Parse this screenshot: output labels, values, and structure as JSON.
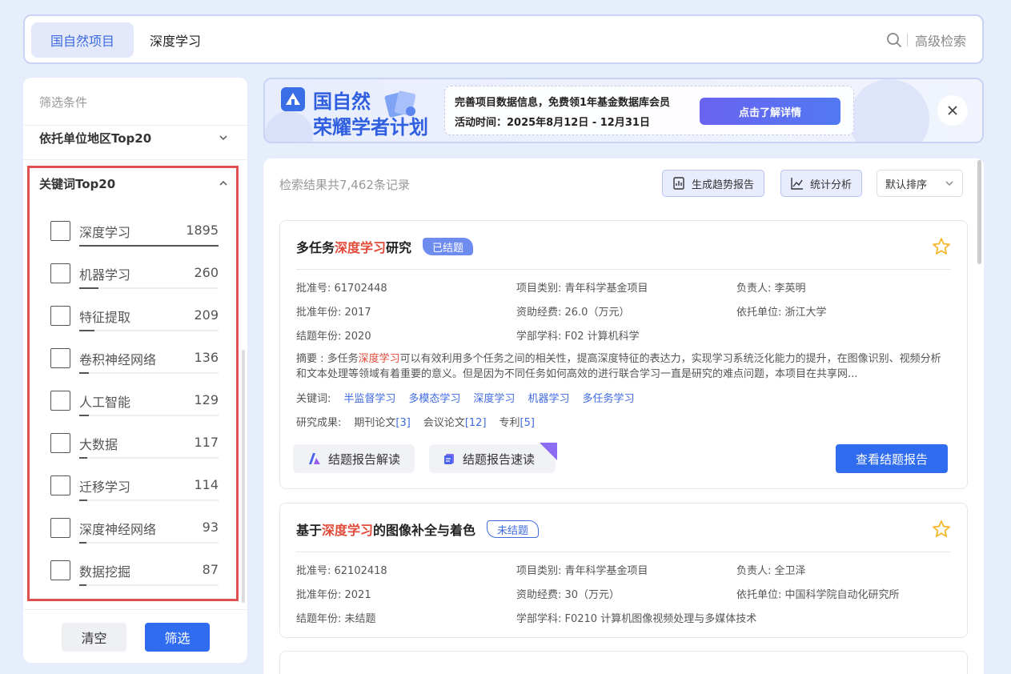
{
  "search": {
    "tab_label": "国自然项目",
    "query": "深度学习",
    "advanced_label": "高级检索"
  },
  "sidebar": {
    "title": "筛选条件",
    "section_region": "依托单位地区Top20",
    "section_keywords": "关键词Top20",
    "keywords": [
      {
        "label": "深度学习",
        "count": "1895",
        "share": 1.0
      },
      {
        "label": "机器学习",
        "count": "260",
        "share": 0.14
      },
      {
        "label": "特征提取",
        "count": "209",
        "share": 0.11
      },
      {
        "label": "卷积神经网络",
        "count": "136",
        "share": 0.07
      },
      {
        "label": "人工智能",
        "count": "129",
        "share": 0.07
      },
      {
        "label": "大数据",
        "count": "117",
        "share": 0.06
      },
      {
        "label": "迁移学习",
        "count": "114",
        "share": 0.06
      },
      {
        "label": "深度神经网络",
        "count": "93",
        "share": 0.05
      },
      {
        "label": "数据挖掘",
        "count": "87",
        "share": 0.05
      }
    ],
    "clear_label": "清空",
    "filter_label": "筛选"
  },
  "banner": {
    "title_line1": "国自然",
    "title_line2": "荣耀学者计划",
    "info_line1": "完善项目数据信息，免费领1年基金数据库会员",
    "info_line2": "活动时间：2025年8月12日 - 12月31日",
    "button_label": "点击了解详情"
  },
  "results": {
    "count_text": "检索结果共7,462条记录",
    "trend_report_label": "生成趋势报告",
    "stats_label": "统计分析",
    "sort_label": "默认排序",
    "cards": [
      {
        "title_pre": "多任务",
        "title_hl": "深度学习",
        "title_post": "研究",
        "status": "已结题",
        "approval_no": "批准号: 61702448",
        "category": "项目类别: 青年科学基金项目",
        "leader": "负责人: 李英明",
        "approval_year": "批准年份: 2017",
        "funding": "资助经费: 26.0（万元）",
        "institution": "依托单位: 浙江大学",
        "end_year": "结题年份: 2020",
        "discipline": "学部学科: F02 计算机科学",
        "abstract_pre": "摘要 : 多任务",
        "abstract_hl": "深度学习",
        "abstract_post": "可以有效利用多个任务之间的相关性，提高深度特征的表达力，实现学习系统泛化能力的提升，在图像识别、视频分析和文本处理等领域有着重要的意义。但是因为不同任务如何高效的进行联合学习一直是研究的难点问题，本项目在共享网...",
        "keywords_label": "关键词:",
        "keywords": [
          "半监督学习",
          "多模态学习",
          "深度学习",
          "机器学习",
          "多任务学习"
        ],
        "outputs_label": "研究成果:",
        "journal_label": "期刊论文",
        "journal_count": "[3]",
        "conference_label": "会议论文",
        "conference_count": "[12]",
        "patent_label": "专利",
        "patent_count": "[5]",
        "interpret_label": "结题报告解读",
        "quickread_label": "结题报告速读",
        "view_label": "查看结题报告"
      },
      {
        "title_pre": "基于",
        "title_hl": "深度学习",
        "title_post": "的图像补全与着色",
        "status": "未结题",
        "approval_no": "批准号: 62102418",
        "category": "项目类别: 青年科学基金项目",
        "leader": "负责人: 全卫泽",
        "approval_year": "批准年份: 2021",
        "funding": "资助经费: 30（万元）",
        "institution": "依托单位: 中国科学院自动化研究所",
        "end_year": "结题年份: 未结题",
        "discipline": "学部学科: F0210 计算机图像视频处理与多媒体技术"
      }
    ]
  }
}
